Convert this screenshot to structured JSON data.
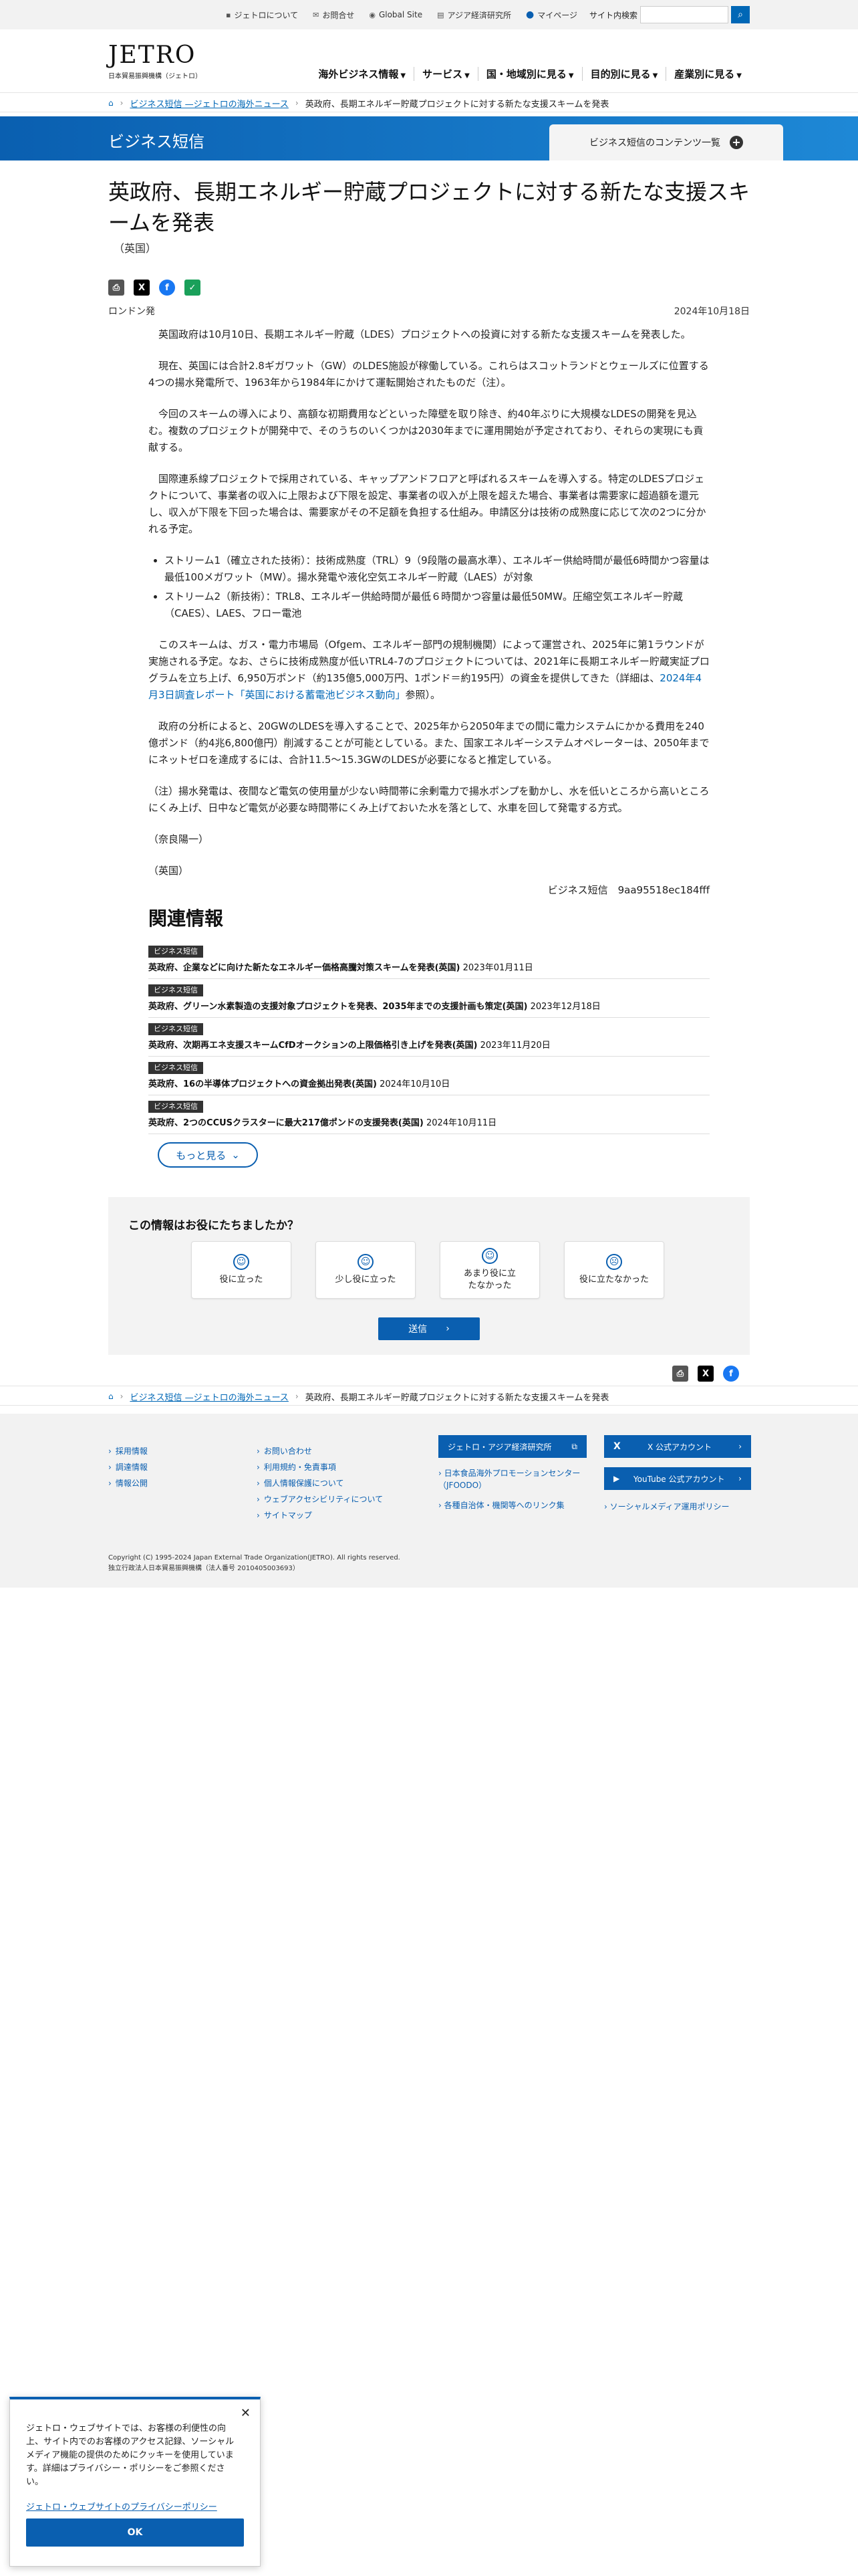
{
  "util": {
    "items": [
      {
        "icon": "info-icon",
        "label": "ジェトロについて"
      },
      {
        "icon": "mail-icon",
        "label": "お問合せ"
      },
      {
        "icon": "globe-icon",
        "label": "Global Site"
      },
      {
        "icon": "book-icon",
        "label": "アジア経済研究所"
      },
      {
        "icon": "user-icon",
        "label": "マイページ"
      }
    ],
    "search_label": "サイト内検索",
    "search_placeholder": ""
  },
  "logo": {
    "word": "JETRO",
    "sub": "日本貿易振興機構（ジェトロ）"
  },
  "gnav": [
    "海外ビジネス情報",
    "サービス",
    "国・地域別に見る",
    "目的別に見る",
    "産業別に見る"
  ],
  "breadcrumb": {
    "link": "ビジネス短信 —ジェトロの海外ニュース",
    "current": "英政府、長期エネルギー貯蔵プロジェクトに対する新たな支援スキームを発表"
  },
  "banner": {
    "title": "ビジネス短信",
    "tab": "ビジネス短信のコンテンツ一覧"
  },
  "article": {
    "title": "英政府、長期エネルギー貯蔵プロジェクトに対する新たな支援スキームを発表",
    "country": "（英国）",
    "place": "ロンドン発",
    "date": "2024年10月18日",
    "p1": "英国政府は10月10日、長期エネルギー貯蔵（LDES）プロジェクトへの投資に対する新たな支援スキームを発表した。",
    "p2": "現在、英国には合計2.8ギガワット（GW）のLDES施設が稼働している。これらはスコットランドとウェールズに位置する4つの揚水発電所で、1963年から1984年にかけて運転開始されたものだ（注）。",
    "p3": "今回のスキームの導入により、高額な初期費用などといった障壁を取り除き、約40年ぶりに大規模なLDESの開発を見込む。複数のプロジェクトが開発中で、そのうちのいくつかは2030年までに運用開始が予定されており、それらの実現にも貢献する。",
    "p4": "国際連系線プロジェクトで採用されている、キャップアンドフロアと呼ばれるスキームを導入する。特定のLDESプロジェクトについて、事業者の収入に上限および下限を設定、事業者の収入が上限を超えた場合、事業者は需要家に超過額を還元し、収入が下限を下回った場合は、需要家がその不足額を負担する仕組み。申請区分は技術の成熟度に応じて次の2つに分かれる予定。",
    "li1": "ストリーム1（確立された技術）：技術成熟度（TRL）9（9段階の最高水準）、エネルギー供給時間が最低6時間かつ容量は最低100メガワット（MW）。揚水発電や液化空気エネルギー貯蔵（LAES）が対象",
    "li2": "ストリーム2（新技術）：TRL8、エネルギー供給時間が最低６時間かつ容量は最低50MW。圧縮空気エネルギー貯蔵（CAES）、LAES、フロー電池",
    "p5a": "このスキームは、ガス・電力市場局（Ofgem、エネルギー部門の規制機関）によって運営され、2025年に第1ラウンドが実施される予定。なお、さらに技術成熟度が低いTRL4-7のプロジェクトについては、2021年に長期エネルギー貯蔵実証プログラムを立ち上げ、6,950万ポンド（約135億5,000万円、1ポンド＝約195円）の資金を提供してきた（詳細は、",
    "p5link": "2024年4月3日調査レポート「英国における蓄電池ビジネス動向」",
    "p5b": "参照）。",
    "p6": "政府の分析によると、20GWのLDESを導入することで、2025年から2050年までの間に電力システムにかかる費用を240億ポンド（約4兆6,800億円）削減することが可能としている。また、国家エネルギーシステムオペレーターは、2050年までにネットゼロを達成するには、合計11.5〜15.3GWのLDESが必要になると推定している。",
    "note": "（注）揚水発電は、夜間など電気の使用量が少ない時間帯に余剰電力で揚水ポンプを動かし、水を低いところから高いところにくみ上げ、日中など電気が必要な時間帯にくみ上げておいた水を落として、水車を回して発電する方式。",
    "author": "（奈良陽一）",
    "country2": "（英国）",
    "sig": "ビジネス短信　9aa95518ec184fff"
  },
  "related": {
    "heading": "関連情報",
    "items": [
      {
        "badge": "ビジネス短信",
        "title": "英政府、企業などに向けた新たなエネルギー価格高騰対策スキームを発表(英国)",
        "date": "2023年01月11日"
      },
      {
        "badge": "ビジネス短信",
        "title": "英政府、グリーン水素製造の支援対象プロジェクトを発表、2035年までの支援計画も策定(英国)",
        "date": "2023年12月18日"
      },
      {
        "badge": "ビジネス短信",
        "title": "英政府、次期再エネ支援スキームCfDオークションの上限価格引き上げを発表(英国)",
        "date": "2023年11月20日"
      },
      {
        "badge": "ビジネス短信",
        "title": "英政府、16の半導体プロジェクトへの資金拠出発表(英国)",
        "date": "2024年10月10日"
      },
      {
        "badge": "ビジネス短信",
        "title": "英政府、2つのCCUSクラスターに最大217億ポンドの支援発表(英国)",
        "date": "2024年10月11日"
      }
    ],
    "more": "もっと見る"
  },
  "survey": {
    "question": "この情報はお役にたちましたか？",
    "options": [
      "役に立った",
      "少し役に立った",
      "あまり役に立たなかった",
      "役に立たなかった"
    ],
    "submit": "送信"
  },
  "footer": {
    "col1": [
      "採用情報",
      "調達情報",
      "情報公開"
    ],
    "col2": [
      "お問い合わせ",
      "利用規約・免責事項",
      "個人情報保護について",
      "ウェブアクセシビリティについて",
      "サイトマップ"
    ],
    "btn_ide": "ジェトロ・アジア経済研究所",
    "link_jfoodo": "日本食品海外プロモーションセンター（JFOODO）",
    "link_local": "各種自治体・機関等へのリンク集",
    "btn_x": "X 公式アカウント",
    "btn_yt": "YouTube 公式アカウント",
    "link_sm": "ソーシャルメディア運用ポリシー",
    "copyright": "Copyright (C) 1995-2024 Japan External Trade Organization(JETRO). All rights reserved.",
    "corp": "独立行政法人日本貿易振興機構（法人番号 2010405003693）"
  },
  "cookie": {
    "text": "ジェトロ・ウェブサイトでは、お客様の利便性の向上、サイト内でのお客様のアクセス記録、ソーシャルメディア機能の提供のためにクッキーを使用しています。詳細はプライバシー・ポリシーをご参照ください。",
    "link": "ジェトロ・ウェブサイトのプライバシーポリシー",
    "ok": "OK"
  }
}
